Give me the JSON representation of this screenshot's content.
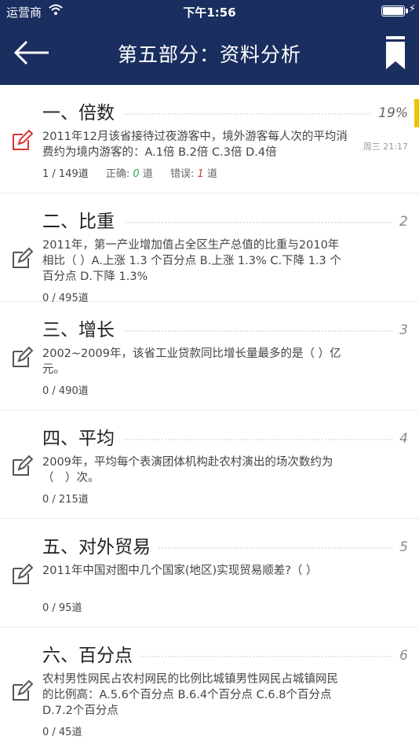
{
  "status_bar": {
    "carrier": "运营商",
    "time": "下午1:56"
  },
  "header": {
    "title": "第五部分：资料分析"
  },
  "colors": {
    "header_bg": "#1a2e5f",
    "accent": "#f2c200",
    "correct": "#2ba84a",
    "wrong": "#d9352f",
    "active_icon": "#d9352f"
  },
  "sections": [
    {
      "chapter": "一、倍数",
      "num": "19%",
      "preview": "2011年12月该省接待过夜游客中，境外游客每人次的平均消费约为境内游客的：A.1倍 B.2倍 C.3倍 D.4倍",
      "progress": "1 / 149道",
      "correct_label": "正确:",
      "correct_count": "0",
      "correct_unit": "道",
      "wrong_label": "错误:",
      "wrong_count": "1",
      "wrong_unit": "道",
      "date": "周三 21:17"
    },
    {
      "chapter": "二、比重",
      "num": "2",
      "preview": "2011年，第一产业增加值占全区生产总值的比重与2010年相比（ ）A.上涨 1.3 个百分点 B.上涨 1.3% C.下降 1.3 个百分点 D.下降 1.3%",
      "progress": "0 / 495道"
    },
    {
      "chapter": "三、增长",
      "num": "3",
      "preview": "2002~2009年，该省工业贷款同比增长量最多的是（ ）亿元。",
      "progress": "0 / 490道"
    },
    {
      "chapter": "四、平均",
      "num": "4",
      "preview": "2009年，平均每个表演团体机构赴农村演出的场次数约为（　）次。",
      "progress": "0 / 215道"
    },
    {
      "chapter": "五、对外贸易",
      "num": "5",
      "preview": "2011年中国对图中几个国家(地区)实现贸易顺差?（ ）",
      "progress": "0 / 95道"
    },
    {
      "chapter": "六、百分点",
      "num": "6",
      "preview": "农村男性网民占农村网民的比例比城镇男性网民占城镇网民的比例高：A.5.6个百分点 B.6.4个百分点 C.6.8个百分点 D.7.2个百分点",
      "progress": "0 / 45道"
    }
  ]
}
